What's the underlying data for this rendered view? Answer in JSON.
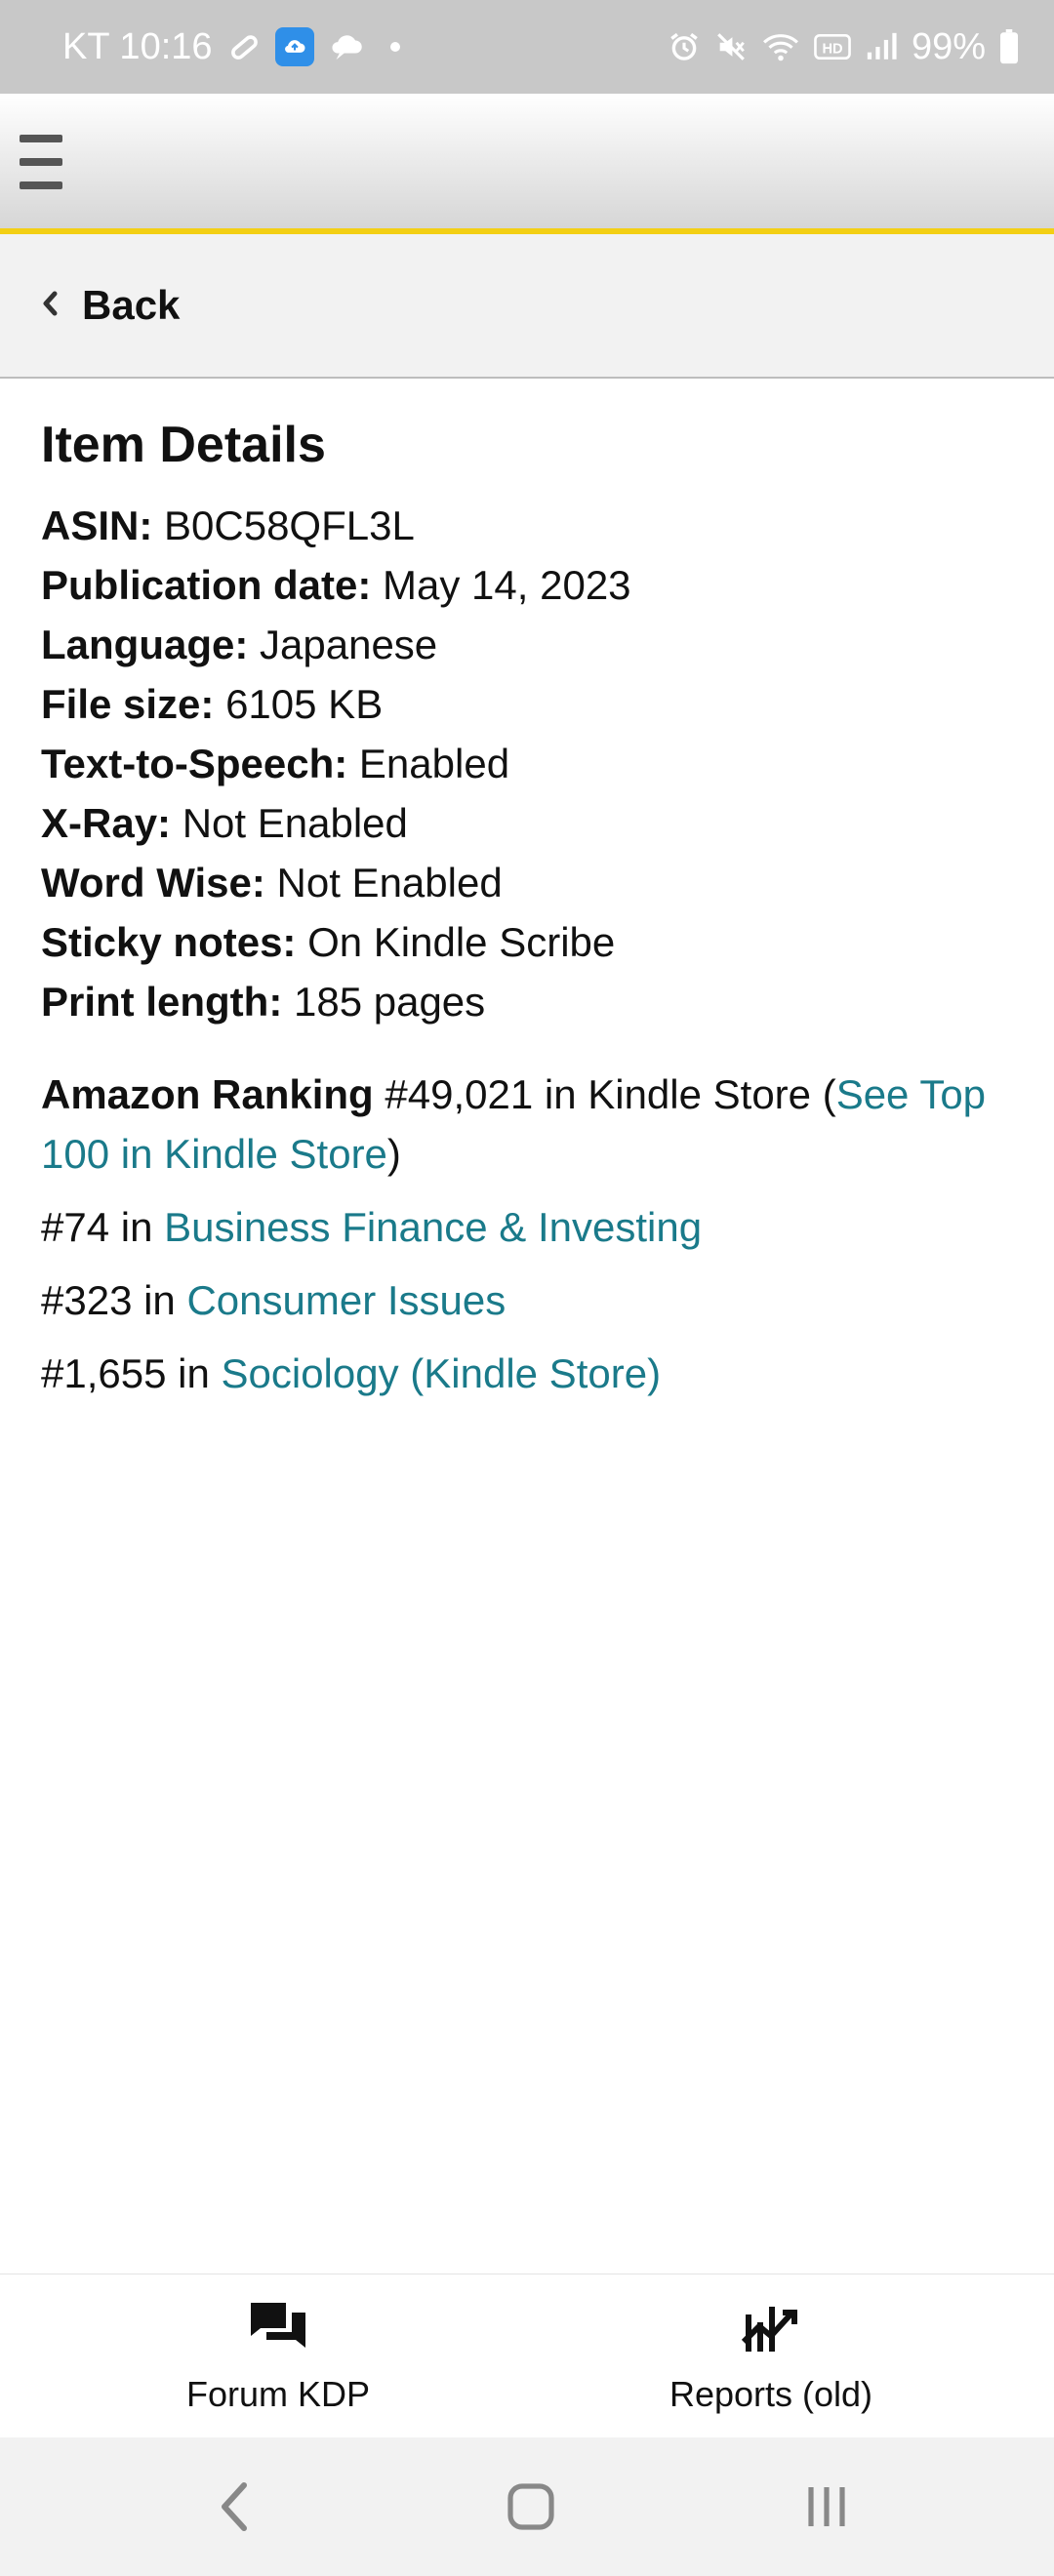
{
  "status_bar": {
    "carrier_time": "KT 10:16",
    "battery": "99%",
    "icons": [
      "link-icon",
      "cloud-upload-app-icon",
      "chat-cloud-icon",
      "notification-dot",
      "alarm-icon",
      "mute-icon",
      "wifi-icon",
      "hd-icon",
      "signal-icon",
      "battery-icon"
    ]
  },
  "app_bar": {
    "menu_icon": "hamburger-menu-icon",
    "accent_color": "#f3cf14"
  },
  "back": {
    "label": "Back",
    "icon": "chevron-left-icon"
  },
  "item_details": {
    "title": "Item Details",
    "rows": [
      {
        "label": "ASIN:",
        "value": "B0C58QFL3L"
      },
      {
        "label": "Publication date:",
        "value": "May 14, 2023"
      },
      {
        "label": "Language:",
        "value": "Japanese"
      },
      {
        "label": "File size:",
        "value": "6105 KB"
      },
      {
        "label": "Text-to-Speech:",
        "value": "Enabled"
      },
      {
        "label": "X-Ray:",
        "value": "Not Enabled"
      },
      {
        "label": "Word Wise:",
        "value": "Not Enabled"
      },
      {
        "label": "Sticky notes:",
        "value": "On Kindle Scribe"
      },
      {
        "label": "Print length:",
        "value": "185 pages"
      }
    ]
  },
  "ranking": {
    "label": "Amazon Ranking",
    "store_rank": "#49,021 in Kindle Store (",
    "top100_link": "See Top 100 in Kindle Store",
    "close_paren": ")",
    "categories": [
      {
        "rank": "#74 in",
        "name": "Business Finance & Investing"
      },
      {
        "rank": "#323 in",
        "name": "Consumer Issues"
      },
      {
        "rank": "#1,655 in",
        "name": "Sociology (Kindle Store)"
      }
    ],
    "link_color": "#1a7a8a"
  },
  "bottom_tabs": [
    {
      "label": "Forum KDP",
      "icon": "forum-chat-icon"
    },
    {
      "label": "Reports (old)",
      "icon": "reports-chart-icon"
    }
  ],
  "nav_bar": {
    "icons": [
      "back-nav-icon",
      "home-nav-icon",
      "recents-nav-icon"
    ]
  }
}
